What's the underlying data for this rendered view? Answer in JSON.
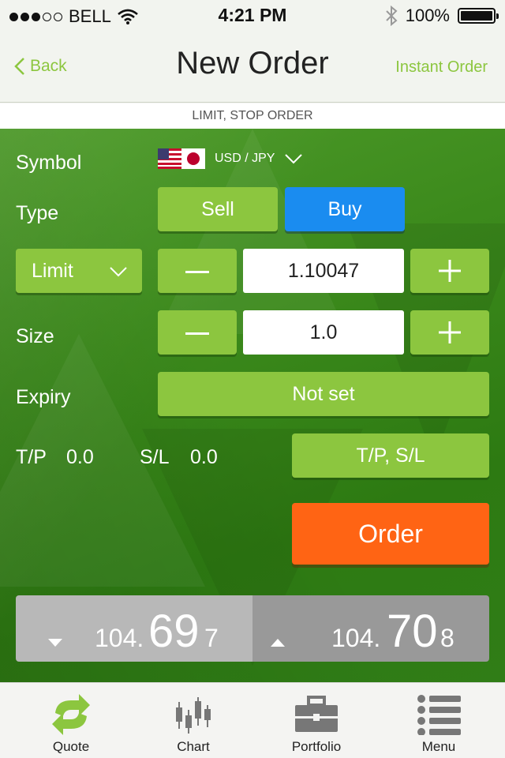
{
  "status_bar": {
    "carrier": "BELL",
    "time": "4:21 PM",
    "battery": "100%",
    "battery_level": 1.0,
    "signal_bars": 3,
    "signal_total": 5
  },
  "nav": {
    "back_label": "Back",
    "title": "New Order",
    "instant_label": "Instant Order"
  },
  "sub_header": "LIMIT, STOP ORDER",
  "form": {
    "symbol_label": "Symbol",
    "symbol_value": "USD / JPY",
    "type_label": "Type",
    "sell_label": "Sell",
    "buy_label": "Buy",
    "order_type": "Limit",
    "price_value": "1.10047",
    "size_label": "Size",
    "size_value": "1.0",
    "expiry_label": "Expiry",
    "expiry_value": "Not set",
    "tp_label": "T/P",
    "tp_value": "0.0",
    "sl_label": "S/L",
    "sl_value": "0.0",
    "tpsl_button": "T/P, S/L",
    "order_button": "Order"
  },
  "prices": {
    "sell": {
      "prefix": "104.",
      "big": "69",
      "suffix": "7"
    },
    "buy": {
      "prefix": "104.",
      "big": "70",
      "suffix": "8"
    }
  },
  "tabs": [
    {
      "label": "Quote",
      "icon": "refresh-arrows-icon"
    },
    {
      "label": "Chart",
      "icon": "candlestick-chart-icon"
    },
    {
      "label": "Portfolio",
      "icon": "briefcase-icon"
    },
    {
      "label": "Menu",
      "icon": "list-menu-icon"
    }
  ],
  "colors": {
    "accent_green": "#8cc63f",
    "buy_blue": "#1a8cf0",
    "order_orange": "#ff6414",
    "background_green": "#3c8a1c"
  }
}
